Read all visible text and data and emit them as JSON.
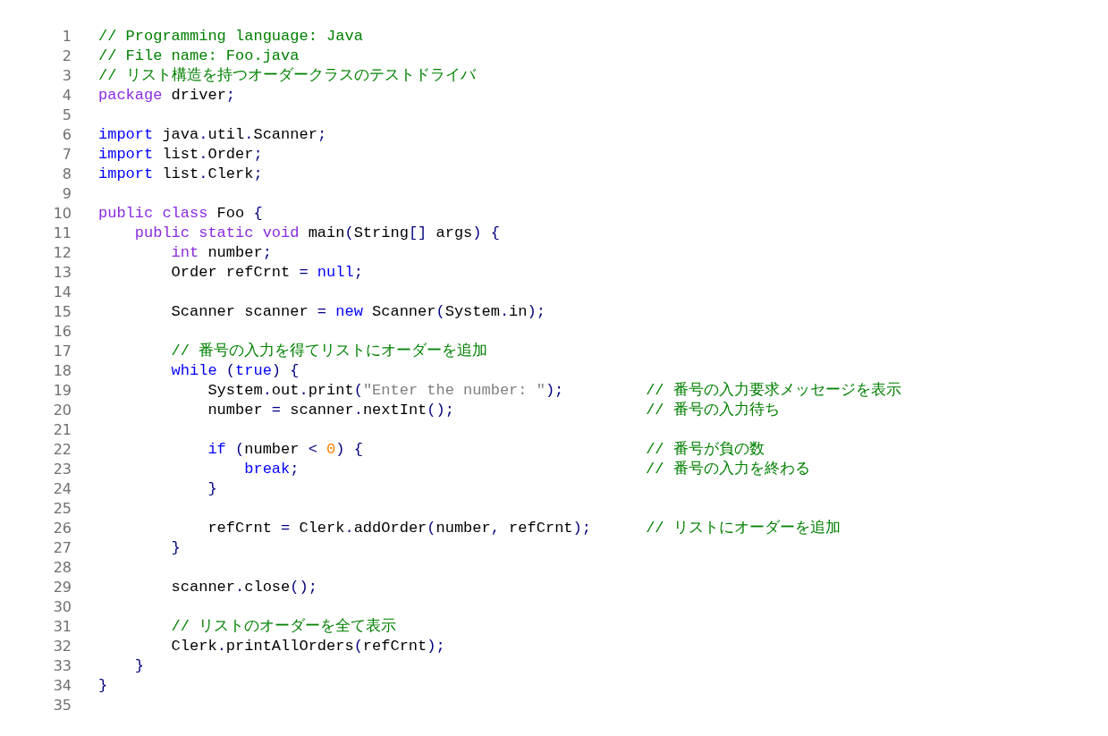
{
  "code_lines": [
    {
      "number": "1",
      "tokens": [
        {
          "text": "// Programming language: Java",
          "kind": "comment"
        }
      ]
    },
    {
      "number": "2",
      "tokens": [
        {
          "text": "// File name: Foo.java",
          "kind": "comment"
        }
      ]
    },
    {
      "number": "3",
      "tokens": [
        {
          "text": "// リスト構造を持つオーダークラスのテストドライバ",
          "kind": "comment"
        }
      ]
    },
    {
      "number": "4",
      "tokens": [
        {
          "text": "package",
          "kind": "keyword"
        },
        {
          "text": " driver",
          "kind": "plain"
        },
        {
          "text": ";",
          "kind": "punct"
        }
      ]
    },
    {
      "number": "5"
    },
    {
      "number": "6",
      "tokens": [
        {
          "text": "import",
          "kind": "control"
        },
        {
          "text": " java",
          "kind": "plain"
        },
        {
          "text": ".",
          "kind": "punct"
        },
        {
          "text": "util",
          "kind": "plain"
        },
        {
          "text": ".",
          "kind": "punct"
        },
        {
          "text": "Scanner",
          "kind": "plain"
        },
        {
          "text": ";",
          "kind": "punct"
        }
      ]
    },
    {
      "number": "7",
      "tokens": [
        {
          "text": "import",
          "kind": "control"
        },
        {
          "text": " list",
          "kind": "plain"
        },
        {
          "text": ".",
          "kind": "punct"
        },
        {
          "text": "Order",
          "kind": "plain"
        },
        {
          "text": ";",
          "kind": "punct"
        }
      ]
    },
    {
      "number": "8",
      "tokens": [
        {
          "text": "import",
          "kind": "control"
        },
        {
          "text": " list",
          "kind": "plain"
        },
        {
          "text": ".",
          "kind": "punct"
        },
        {
          "text": "Clerk",
          "kind": "plain"
        },
        {
          "text": ";",
          "kind": "punct"
        }
      ]
    },
    {
      "number": "9"
    },
    {
      "number": "10",
      "tokens": [
        {
          "text": "public class",
          "kind": "keyword"
        },
        {
          "text": " Foo ",
          "kind": "plain"
        },
        {
          "text": "{",
          "kind": "punct"
        }
      ]
    },
    {
      "number": "11",
      "tokens": [
        {
          "text": "    public static void",
          "kind": "keyword"
        },
        {
          "text": " main",
          "kind": "plain"
        },
        {
          "text": "(",
          "kind": "punct"
        },
        {
          "text": "String",
          "kind": "plain"
        },
        {
          "text": "[]",
          "kind": "punct"
        },
        {
          "text": " args",
          "kind": "plain"
        },
        {
          "text": ") {",
          "kind": "punct"
        }
      ]
    },
    {
      "number": "12",
      "tokens": [
        {
          "text": "        int",
          "kind": "keyword"
        },
        {
          "text": " number",
          "kind": "plain"
        },
        {
          "text": ";",
          "kind": "punct"
        }
      ]
    },
    {
      "number": "13",
      "tokens": [
        {
          "text": "        Order refCrnt ",
          "kind": "plain"
        },
        {
          "text": "=",
          "kind": "punct"
        },
        {
          "text": " null",
          "kind": "control"
        },
        {
          "text": ";",
          "kind": "punct"
        }
      ]
    },
    {
      "number": "14"
    },
    {
      "number": "15",
      "tokens": [
        {
          "text": "        Scanner scanner ",
          "kind": "plain"
        },
        {
          "text": "=",
          "kind": "punct"
        },
        {
          "text": " new",
          "kind": "control"
        },
        {
          "text": " Scanner",
          "kind": "plain"
        },
        {
          "text": "(",
          "kind": "punct"
        },
        {
          "text": "System",
          "kind": "plain"
        },
        {
          "text": ".",
          "kind": "punct"
        },
        {
          "text": "in",
          "kind": "plain"
        },
        {
          "text": ");",
          "kind": "punct"
        }
      ]
    },
    {
      "number": "16"
    },
    {
      "number": "17",
      "tokens": [
        {
          "text": "        // 番号の入力を得てリストにオーダーを追加",
          "kind": "comment"
        }
      ]
    },
    {
      "number": "18",
      "tokens": [
        {
          "text": "        while",
          "kind": "control"
        },
        {
          "text": " (",
          "kind": "punct"
        },
        {
          "text": "true",
          "kind": "control"
        },
        {
          "text": ") {",
          "kind": "punct"
        }
      ]
    },
    {
      "number": "19",
      "tokens": [
        {
          "text": "            System",
          "kind": "plain"
        },
        {
          "text": ".",
          "kind": "punct"
        },
        {
          "text": "out",
          "kind": "plain"
        },
        {
          "text": ".",
          "kind": "punct"
        },
        {
          "text": "print",
          "kind": "plain"
        },
        {
          "text": "(",
          "kind": "punct"
        },
        {
          "text": "\"Enter the number: \"",
          "kind": "string"
        },
        {
          "text": ");",
          "kind": "punct"
        },
        {
          "text": "         // 番号の入力要求メッセージを表示",
          "kind": "comment"
        }
      ]
    },
    {
      "number": "20",
      "tokens": [
        {
          "text": "            number ",
          "kind": "plain"
        },
        {
          "text": "=",
          "kind": "punct"
        },
        {
          "text": " scanner",
          "kind": "plain"
        },
        {
          "text": ".",
          "kind": "punct"
        },
        {
          "text": "nextInt",
          "kind": "plain"
        },
        {
          "text": "();",
          "kind": "punct"
        },
        {
          "text": "                     // 番号の入力待ち",
          "kind": "comment"
        }
      ]
    },
    {
      "number": "21"
    },
    {
      "number": "22",
      "tokens": [
        {
          "text": "            if",
          "kind": "control"
        },
        {
          "text": " (",
          "kind": "punct"
        },
        {
          "text": "number ",
          "kind": "plain"
        },
        {
          "text": "<",
          "kind": "punct"
        },
        {
          "text": " 0",
          "kind": "numeral"
        },
        {
          "text": ") {",
          "kind": "punct"
        },
        {
          "text": "                               // 番号が負の数",
          "kind": "comment"
        }
      ]
    },
    {
      "number": "23",
      "tokens": [
        {
          "text": "                break",
          "kind": "control"
        },
        {
          "text": ";",
          "kind": "punct"
        },
        {
          "text": "                                      // 番号の入力を終わる",
          "kind": "comment"
        }
      ]
    },
    {
      "number": "24",
      "tokens": [
        {
          "text": "            }",
          "kind": "punct"
        }
      ]
    },
    {
      "number": "25"
    },
    {
      "number": "26",
      "tokens": [
        {
          "text": "            refCrnt ",
          "kind": "plain"
        },
        {
          "text": "=",
          "kind": "punct"
        },
        {
          "text": " Clerk",
          "kind": "plain"
        },
        {
          "text": ".",
          "kind": "punct"
        },
        {
          "text": "addOrder",
          "kind": "plain"
        },
        {
          "text": "(",
          "kind": "punct"
        },
        {
          "text": "number",
          "kind": "plain"
        },
        {
          "text": ",",
          "kind": "punct"
        },
        {
          "text": " refCrnt",
          "kind": "plain"
        },
        {
          "text": ");",
          "kind": "punct"
        },
        {
          "text": "      // リストにオーダーを追加",
          "kind": "comment"
        }
      ]
    },
    {
      "number": "27",
      "tokens": [
        {
          "text": "        }",
          "kind": "punct"
        }
      ]
    },
    {
      "number": "28"
    },
    {
      "number": "29",
      "tokens": [
        {
          "text": "        scanner",
          "kind": "plain"
        },
        {
          "text": ".",
          "kind": "punct"
        },
        {
          "text": "close",
          "kind": "plain"
        },
        {
          "text": "();",
          "kind": "punct"
        }
      ]
    },
    {
      "number": "30"
    },
    {
      "number": "31",
      "tokens": [
        {
          "text": "        // リストのオーダーを全て表示",
          "kind": "comment"
        }
      ]
    },
    {
      "number": "32",
      "tokens": [
        {
          "text": "        Clerk",
          "kind": "plain"
        },
        {
          "text": ".",
          "kind": "punct"
        },
        {
          "text": "printAllOrders",
          "kind": "plain"
        },
        {
          "text": "(",
          "kind": "punct"
        },
        {
          "text": "refCrnt",
          "kind": "plain"
        },
        {
          "text": ");",
          "kind": "punct"
        }
      ]
    },
    {
      "number": "33",
      "tokens": [
        {
          "text": "    }",
          "kind": "punct"
        }
      ]
    },
    {
      "number": "34",
      "tokens": [
        {
          "text": "}",
          "kind": "punct"
        }
      ]
    },
    {
      "number": "35"
    }
  ]
}
